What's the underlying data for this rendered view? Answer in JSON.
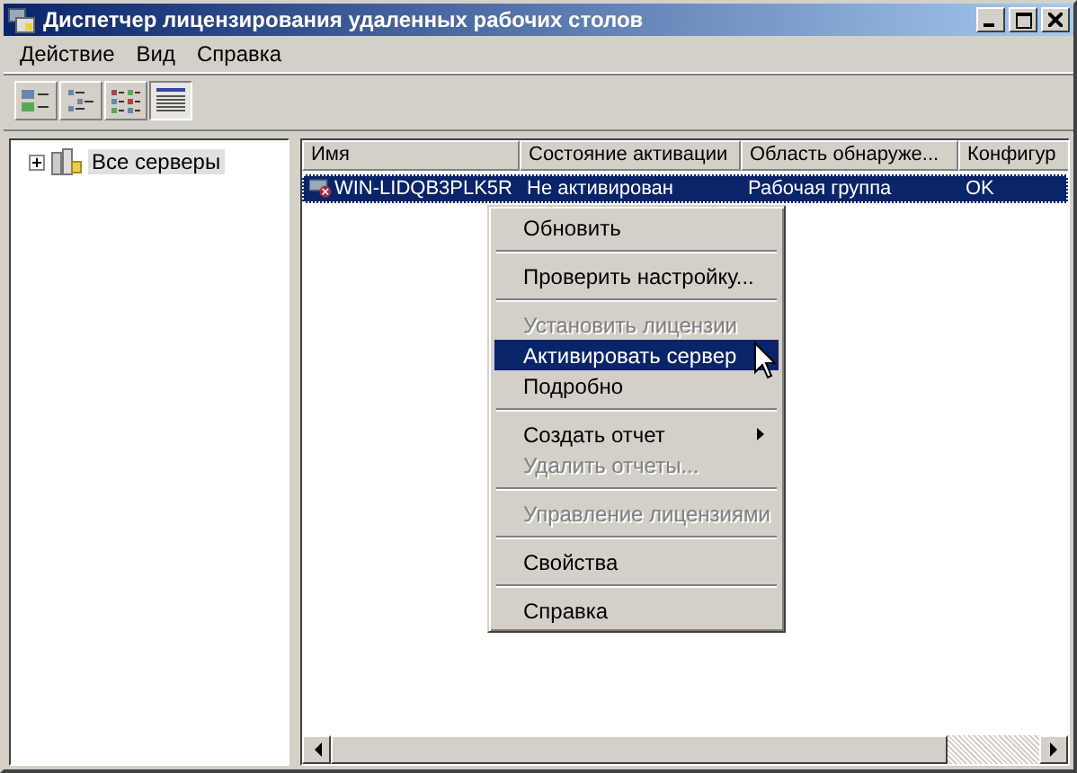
{
  "window": {
    "title": "Диспетчер лицензирования удаленных рабочих столов"
  },
  "menu_bar": [
    "Действие",
    "Вид",
    "Справка"
  ],
  "toolbar": [
    {
      "kind": "large-icons",
      "selected": false
    },
    {
      "kind": "small-icons",
      "selected": false
    },
    {
      "kind": "list",
      "selected": false
    },
    {
      "kind": "details",
      "selected": true
    }
  ],
  "tree": [
    {
      "label": "Все серверы",
      "expanded": false,
      "selected": true
    }
  ],
  "table": {
    "columns": [
      "Имя",
      "Состояние активации",
      "Область обнаруже...",
      "Конфигур"
    ],
    "rows": [
      {
        "cells": [
          "WIN-LIDQB3PLK5R",
          "Не активирован",
          "Рабочая группа",
          "OK"
        ],
        "selected": true
      }
    ]
  },
  "context_menu": [
    {
      "kind": "item",
      "label": "Обновить",
      "disabled": false,
      "selected": false
    },
    {
      "kind": "separator"
    },
    {
      "kind": "item",
      "label": "Проверить настройку...",
      "disabled": false,
      "selected": false
    },
    {
      "kind": "separator"
    },
    {
      "kind": "item",
      "label": "Установить лицензии",
      "disabled": true,
      "selected": false
    },
    {
      "kind": "item",
      "label": "Активировать сервер",
      "disabled": false,
      "selected": true
    },
    {
      "kind": "item",
      "label": "Подробно",
      "disabled": false,
      "selected": false
    },
    {
      "kind": "separator"
    },
    {
      "kind": "submenu",
      "label": "Создать отчет",
      "disabled": false,
      "selected": false
    },
    {
      "kind": "item",
      "label": "Удалить отчеты...",
      "disabled": true,
      "selected": false
    },
    {
      "kind": "separator"
    },
    {
      "kind": "item",
      "label": "Управление лицензиями",
      "disabled": true,
      "selected": false
    },
    {
      "kind": "separator"
    },
    {
      "kind": "item",
      "label": "Свойства",
      "disabled": false,
      "selected": false
    },
    {
      "kind": "separator"
    },
    {
      "kind": "item",
      "label": "Справка",
      "disabled": false,
      "selected": false
    }
  ]
}
